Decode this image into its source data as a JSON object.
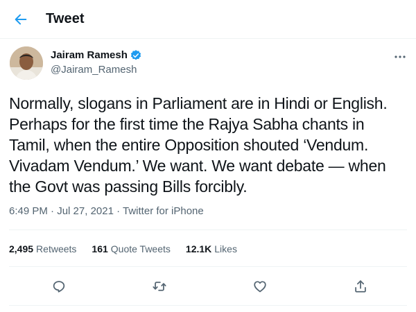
{
  "header": {
    "title": "Tweet",
    "back_icon": "back-arrow-icon",
    "accent_color": "#1d9bf0"
  },
  "author": {
    "name": "Jairam Ramesh",
    "handle": "@Jairam_Ramesh",
    "verified": true
  },
  "tweet": {
    "text_lines": [
      "Normally, slogans in Parliament are in Hindi or English.",
      "Perhaps for the first time the Rajya Sabha chants in",
      "Tamil, when the entire Opposition shouted ‘Vendum.",
      "Vivadam Vendum.’ We want. We want debate — when",
      "the Govt was passing Bills forcibly."
    ]
  },
  "meta": {
    "time": "6:49 PM",
    "sep1": " · ",
    "date": "Jul 27, 2021",
    "sep2": " · ",
    "source": "Twitter for iPhone"
  },
  "stats": {
    "retweets_count": "2,495",
    "retweets_label": "Retweets",
    "quotes_count": "161",
    "quotes_label": "Quote Tweets",
    "likes_count": "12.1K",
    "likes_label": "Likes"
  },
  "actions": [
    "reply-icon",
    "retweet-icon",
    "like-icon",
    "share-icon"
  ]
}
